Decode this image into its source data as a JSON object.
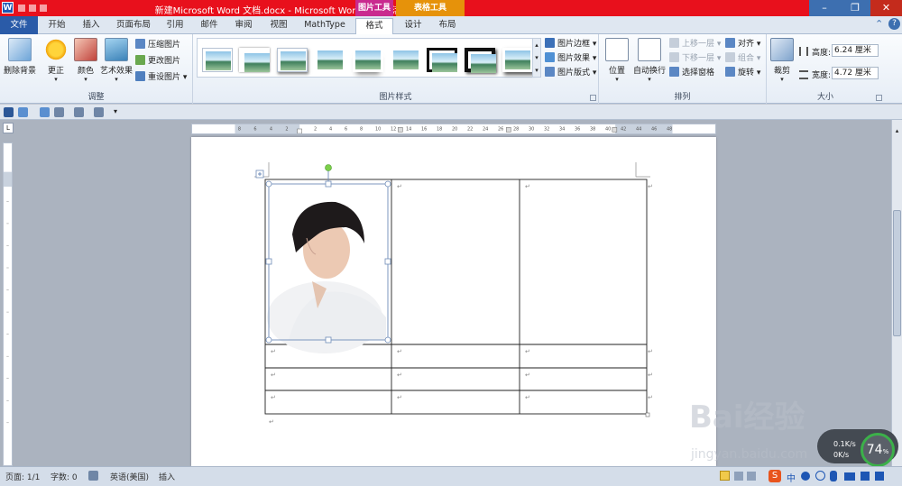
{
  "titlebar": {
    "app_icon": "W",
    "title": "新建Microsoft Word 文档.docx  -  Microsoft Word(产品激活失败)",
    "context_picture": "图片工具",
    "context_table": "表格工具",
    "minimize": "–",
    "maximize": "❐",
    "close": "✕"
  },
  "tabs": {
    "file": "文件",
    "items": [
      "开始",
      "插入",
      "页面布局",
      "引用",
      "邮件",
      "审阅",
      "视图",
      "MathType"
    ],
    "format": "格式",
    "design": "设计",
    "layout": "布局"
  },
  "ribbon": {
    "adjust": {
      "remove_bg": "删除背景",
      "corrections": "更正",
      "color": "颜色",
      "artistic": "艺术效果",
      "compress": "压缩图片",
      "change": "更改图片",
      "reset": "重设图片",
      "label": "调整"
    },
    "styles": {
      "border": "图片边框",
      "effects": "图片效果",
      "layout": "图片版式",
      "label": "图片样式"
    },
    "arrange": {
      "position": "位置",
      "wrap": "自动换行",
      "bring_forward": "上移一层",
      "send_backward": "下移一层",
      "selection_pane": "选择窗格",
      "align": "对齐",
      "group": "组合",
      "rotate": "旋转",
      "label": "排列"
    },
    "size": {
      "crop": "裁剪",
      "height_label": "高度:",
      "height_value": "6.24 厘米",
      "width_label": "宽度:",
      "width_value": "4.72 厘米",
      "label": "大小"
    }
  },
  "ruler": {
    "h_left": [
      "8",
      "6",
      "4",
      "2"
    ],
    "h_right": [
      "2",
      "4",
      "6",
      "8",
      "10",
      "12",
      "14",
      "16",
      "18",
      "20",
      "22",
      "24",
      "26",
      "28",
      "30",
      "32",
      "34",
      "36",
      "38",
      "40",
      "42",
      "44",
      "46",
      "48"
    ],
    "corner": "L"
  },
  "status": {
    "page": "页面: 1/1",
    "words": "字数: 0",
    "lang": "英语(美国)",
    "mode": "插入"
  },
  "overlay": {
    "watermark_line1": "Bai经验",
    "watermark_line2": "jingyan.baidu.com",
    "speed": "0.1K/s",
    "speed2": "0K/s",
    "percent": "74",
    "percent_unit": "%"
  },
  "colors": {
    "titlebar": "#e8101c",
    "file_tab": "#2a5ba8",
    "pic_tools": "#c92a8f",
    "table_tools": "#e6920a"
  }
}
